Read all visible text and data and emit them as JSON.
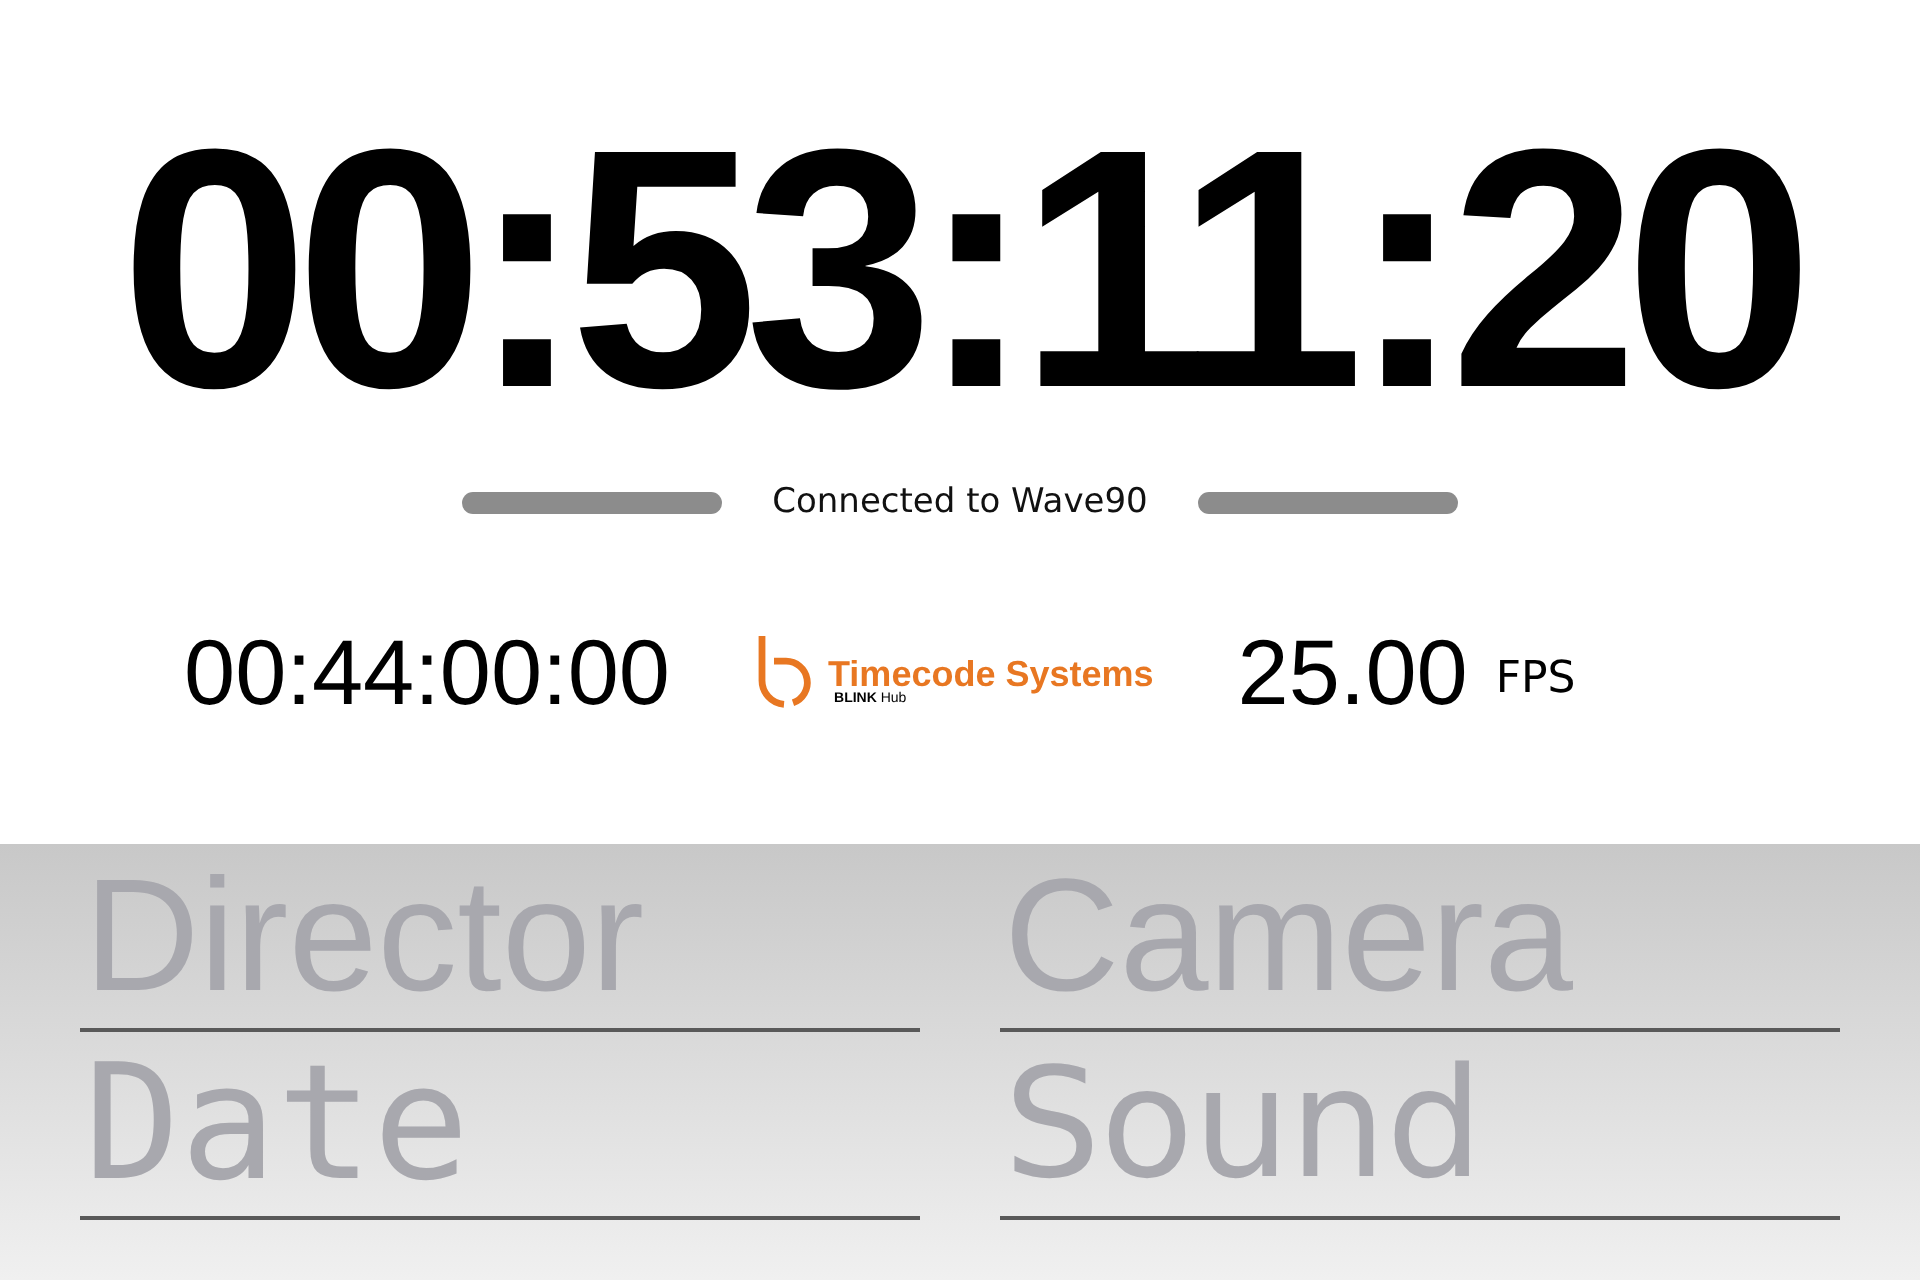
{
  "timecode": {
    "value": "00:53:11:20"
  },
  "connection": {
    "status": "Connected to Wave90"
  },
  "info": {
    "offset_timecode": "00:44:00:00",
    "logo": {
      "name": "Timecode Systems",
      "product": "**BLINK** Hub"
    },
    "frame_rate": "25.00",
    "frame_rate_unit": "FPS"
  },
  "fields": [
    {
      "placeholder": "Director"
    },
    {
      "placeholder": "Camera"
    },
    {
      "placeholder": "Date"
    },
    {
      "placeholder": "Sound"
    }
  ]
}
